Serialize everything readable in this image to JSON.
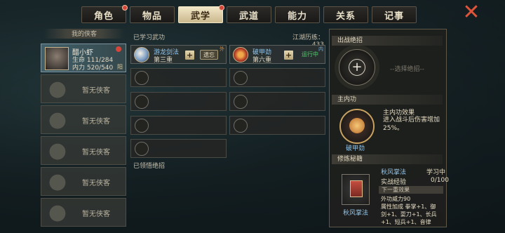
{
  "tabs": [
    {
      "label": "角色",
      "active": false,
      "badge": true
    },
    {
      "label": "物品",
      "active": false,
      "badge": false
    },
    {
      "label": "武学",
      "active": true,
      "badge": true
    },
    {
      "label": "武道",
      "active": false,
      "badge": false
    },
    {
      "label": "能力",
      "active": false,
      "badge": false
    },
    {
      "label": "关系",
      "active": false,
      "badge": false
    },
    {
      "label": "记事",
      "active": false,
      "badge": false
    }
  ],
  "close_icon": "✕",
  "left": {
    "title": "我的侠客",
    "hero": {
      "name": "醋小虾",
      "hp": "生命 111/284",
      "mp": "内力 520/540",
      "tag": "阳"
    },
    "empty_label": "暂无侠客"
  },
  "learned": {
    "title": "已学习武功",
    "jianghu": "江湖历练：433",
    "skill1": {
      "name": "游龙剑法",
      "level": "第三重",
      "action": "遗忘",
      "tag": "外",
      "name_color": "#8fc7f0",
      "tag_color": "#d98a3a"
    },
    "skill2": {
      "name": "破甲劲",
      "level": "第六重",
      "action": "运行中",
      "tag": "内",
      "name_color": "#8fc7f0",
      "tag_color": "#6fb7e8"
    },
    "plus": "+"
  },
  "insight": {
    "title": "已领悟绝招"
  },
  "right": {
    "combat_title": "出战绝招",
    "select_hint": "--选择绝招--",
    "plus": "+",
    "neigong_title": "主内功",
    "neigong_name": "破甲劲",
    "effect_title": "主内功效果",
    "effect_text": "进入战斗后伤害增加25%。",
    "book_title_header": "修炼秘籍",
    "book_name": "秋风掌法",
    "book_status": "学习中",
    "exp_label": "实战经验",
    "exp_value": "0/100",
    "next_label": "下一重效果",
    "line1": "外功威力90",
    "line2": "属性加成    拳掌+1、御",
    "line3": "剑+1、耍刀+1、长兵",
    "line4": "+1、短兵+1、音律"
  }
}
